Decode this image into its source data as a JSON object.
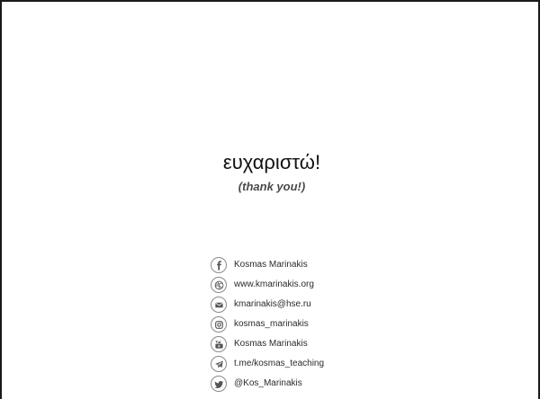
{
  "slide": {
    "title": "ευχαριστώ!",
    "subtitle": "(thank you!)"
  },
  "contacts": [
    {
      "icon": "facebook-icon",
      "label": "Kosmas Marinakis"
    },
    {
      "icon": "web-icon",
      "label": "www.kmarinakis.org"
    },
    {
      "icon": "email-icon",
      "label": "kmarinakis@hse.ru"
    },
    {
      "icon": "instagram-icon",
      "label": "kosmas_marinakis"
    },
    {
      "icon": "youtube-icon",
      "label": "Kosmas Marinakis"
    },
    {
      "icon": "telegram-icon",
      "label": "t.me/kosmas_teaching"
    },
    {
      "icon": "twitter-icon",
      "label": "@Kos_Marinakis"
    }
  ],
  "colors": {
    "icon_color": "#555555",
    "text_color": "#2a2a2a",
    "border_color": "#1a1a1a"
  }
}
